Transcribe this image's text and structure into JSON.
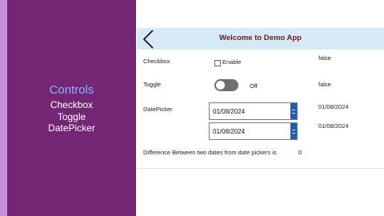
{
  "slide": {
    "title": "Controls",
    "items": [
      "Checkbox",
      "Toggle",
      "DatePicker"
    ]
  },
  "app": {
    "header_title": "Welcome to Demo App",
    "back_icon": "chevron-left-icon",
    "checkbox": {
      "label": "Checkbox",
      "option": "Enable",
      "checked": false,
      "value": "false"
    },
    "toggle": {
      "label": "Toggle",
      "state_text": "Off",
      "on": false,
      "value": "false"
    },
    "datepicker": {
      "label": "DatePicker",
      "date1": "01/08/2024",
      "date2": "01/08/2024",
      "value1": "01/08/2024",
      "value2": "01/08/2024"
    },
    "difference": {
      "label": "Difference Between two dates from date pickers is",
      "value": "0"
    }
  },
  "colors": {
    "slide_panel": "#732673",
    "slide_stripe": "#c68fd9",
    "slide_title": "#8fb3ff",
    "header_bg": "#d6e9f7",
    "header_text": "#6a1b1b",
    "toggle_off": "#6e6e6e",
    "date_button": "#1a5fb4"
  }
}
